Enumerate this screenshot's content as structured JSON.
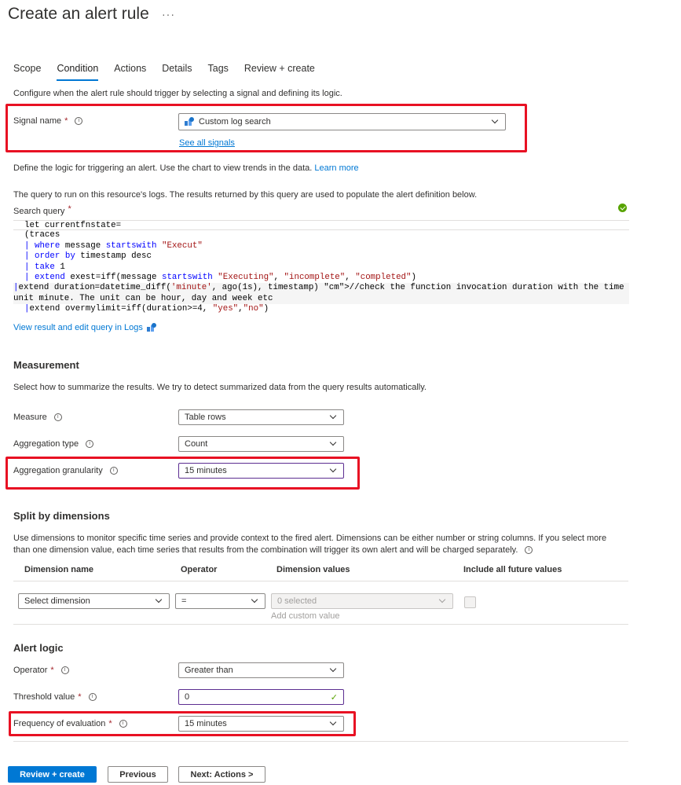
{
  "page_title": "Create an alert rule",
  "more_label": "···",
  "tabs": [
    "Scope",
    "Condition",
    "Actions",
    "Details",
    "Tags",
    "Review + create"
  ],
  "condition_intro": "Configure when the alert rule should trigger by selecting a signal and defining its logic.",
  "signal": {
    "label": "Signal name",
    "required": "*",
    "value": "Custom log search",
    "see_all": "See all signals"
  },
  "logic_intro": "Define the logic for triggering an alert. Use the chart to view trends in the data.",
  "learn_more": "Learn more",
  "query_intro": "The query to run on this resource's logs. The results returned by this query are used to populate the alert definition below.",
  "search_query_label": "Search query",
  "query_lines": [
    "let currentfnstate=",
    "(traces",
    "| where message startswith \"Execut\"",
    "| order by timestamp desc",
    "| take 1",
    "| extend exest=iff(message startswith \"Executing\", \"incomplete\", \"completed\")",
    "|extend duration=datetime_diff('minute', ago(1s), timestamp) //check the function invocation duration with the time",
    "unit minute. The unit can be hour, day and week etc",
    "|extend overmylimit=iff(duration>=4, \"yes\",\"no\")"
  ],
  "view_logs": "View result and edit query in Logs",
  "measurement": {
    "heading": "Measurement",
    "intro": "Select how to summarize the results. We try to detect summarized data from the query results automatically.",
    "measure_label": "Measure",
    "measure_value": "Table rows",
    "aggregation_type_label": "Aggregation type",
    "aggregation_type_value": "Count",
    "granularity_label": "Aggregation granularity",
    "granularity_value": "15 minutes"
  },
  "split": {
    "heading": "Split by dimensions",
    "intro_line1": "Use dimensions to monitor specific time series and provide context to the fired alert. Dimensions can be either number or string columns. If you select more",
    "intro_line2": "than one dimension value, each time series that results from the combination will trigger its own alert and will be charged separately.",
    "columns": [
      "Dimension name",
      "Operator",
      "Dimension values",
      "Include all future values"
    ],
    "dimension_placeholder": "Select dimension",
    "operator_value": "=",
    "values_placeholder": "0 selected",
    "add_custom": "Add custom value"
  },
  "alert_logic": {
    "heading": "Alert logic",
    "operator_label": "Operator",
    "operator_value": "Greater than",
    "threshold_label": "Threshold value",
    "threshold_value": "0",
    "frequency_label": "Frequency of evaluation",
    "frequency_value": "15 minutes"
  },
  "footer": {
    "review_create": "Review + create",
    "previous": "Previous",
    "next": "Next: Actions >"
  },
  "colors": {
    "accent": "#0078d4",
    "highlight_box": "#e81123",
    "focus_border": "#5c2e91"
  }
}
